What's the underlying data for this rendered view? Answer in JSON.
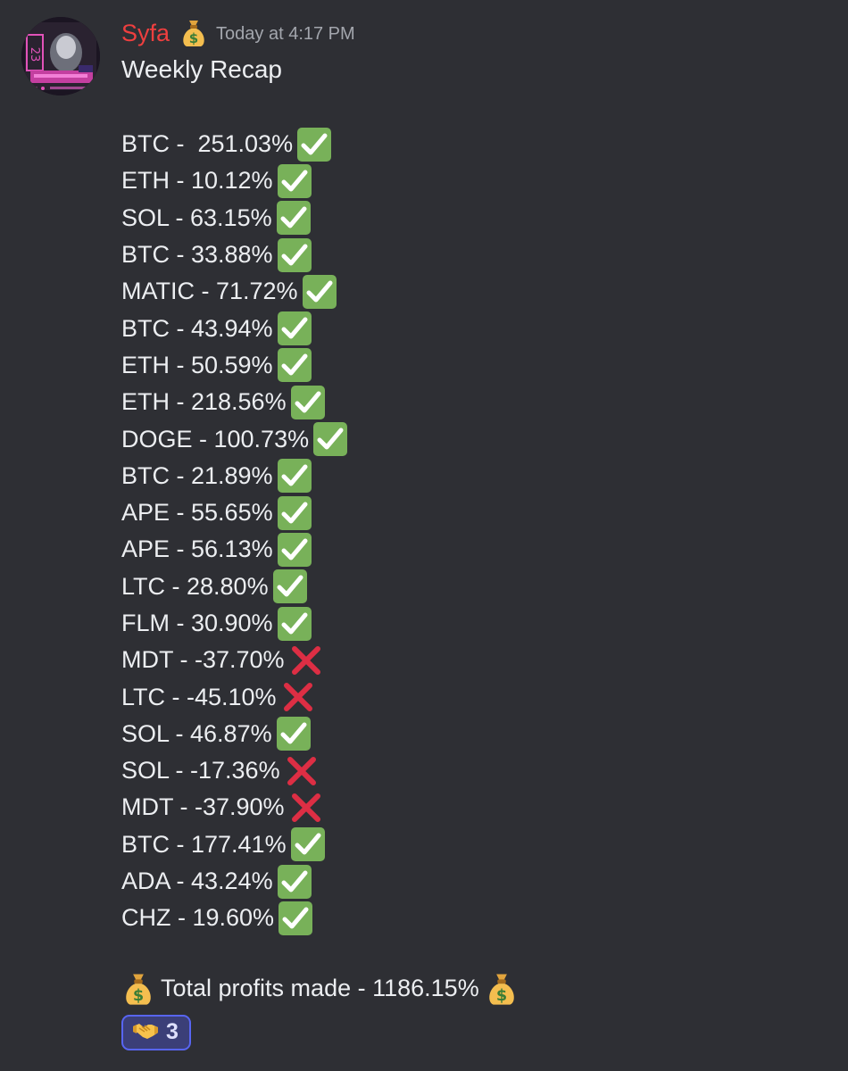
{
  "message": {
    "username": "Syfa",
    "username_color": "#ee3f3f",
    "username_badge_icon": "money-bag-icon",
    "timestamp": "Today at 4:17 PM",
    "title": "Weekly Recap",
    "trades": [
      {
        "text": "BTC -  251.03%",
        "result": "win"
      },
      {
        "text": "ETH - 10.12%",
        "result": "win"
      },
      {
        "text": "SOL - 63.15%",
        "result": "win"
      },
      {
        "text": "BTC - 33.88%",
        "result": "win"
      },
      {
        "text": "MATIC - 71.72%",
        "result": "win"
      },
      {
        "text": "BTC - 43.94%",
        "result": "win"
      },
      {
        "text": "ETH - 50.59%",
        "result": "win"
      },
      {
        "text": "ETH - 218.56%",
        "result": "win"
      },
      {
        "text": "DOGE - 100.73%",
        "result": "win"
      },
      {
        "text": "BTC - 21.89%",
        "result": "win"
      },
      {
        "text": "APE - 55.65%",
        "result": "win"
      },
      {
        "text": "APE - 56.13%",
        "result": "win"
      },
      {
        "text": "LTC - 28.80%",
        "result": "win"
      },
      {
        "text": "FLM - 30.90%",
        "result": "win"
      },
      {
        "text": "MDT - -37.70%",
        "result": "loss"
      },
      {
        "text": "LTC - -45.10%",
        "result": "loss"
      },
      {
        "text": "SOL - 46.87%",
        "result": "win"
      },
      {
        "text": "SOL - -17.36%",
        "result": "loss"
      },
      {
        "text": "MDT - -37.90%",
        "result": "loss"
      },
      {
        "text": "BTC - 177.41%",
        "result": "win"
      },
      {
        "text": "ADA - 43.24%",
        "result": "win"
      },
      {
        "text": "CHZ - 19.60%",
        "result": "win"
      }
    ],
    "total_text": "Total profits made - 1186.15%",
    "total_icon": "money-bag-icon",
    "reaction": {
      "icon": "handshake-icon",
      "count": "3"
    }
  },
  "colors": {
    "background": "#2e2f34",
    "check_green": "#78b159",
    "cross_red": "#dd2e44",
    "reaction_border": "#5865f2"
  }
}
